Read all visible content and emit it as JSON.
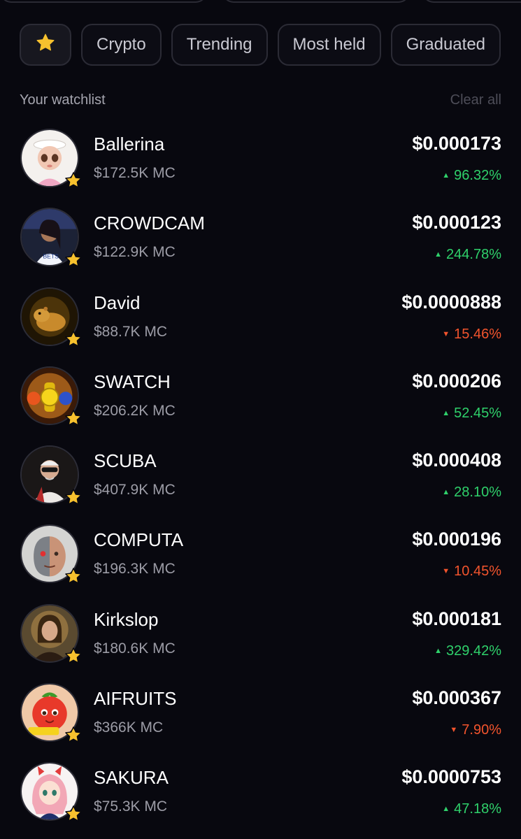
{
  "tabs": [
    {
      "label": "",
      "icon": "star-icon"
    },
    {
      "label": "Crypto"
    },
    {
      "label": "Trending"
    },
    {
      "label": "Most held"
    },
    {
      "label": "Graduated"
    }
  ],
  "watchlist": {
    "title": "Your watchlist",
    "clear_label": "Clear all",
    "items": [
      {
        "name": "Ballerina",
        "mc": "$172.5K MC",
        "price": "$0.000173",
        "change": "96.32%",
        "direction": "up",
        "avatar": "ballerina-avatar-icon"
      },
      {
        "name": "CROWDCAM",
        "mc": "$122.9K MC",
        "price": "$0.000123",
        "change": "244.78%",
        "direction": "up",
        "avatar": "crowdcam-avatar-icon"
      },
      {
        "name": "David",
        "mc": "$88.7K MC",
        "price": "$0.0000888",
        "change": "15.46%",
        "direction": "down",
        "avatar": "capybara-avatar-icon"
      },
      {
        "name": "SWATCH",
        "mc": "$206.2K MC",
        "price": "$0.000206",
        "change": "52.45%",
        "direction": "up",
        "avatar": "watches-avatar-icon"
      },
      {
        "name": "SCUBA",
        "mc": "$407.9K MC",
        "price": "$0.000408",
        "change": "28.10%",
        "direction": "up",
        "avatar": "scuba-avatar-icon"
      },
      {
        "name": "COMPUTA",
        "mc": "$196.3K MC",
        "price": "$0.000196",
        "change": "10.45%",
        "direction": "down",
        "avatar": "cyborg-avatar-icon"
      },
      {
        "name": "Kirkslop",
        "mc": "$180.6K MC",
        "price": "$0.000181",
        "change": "329.42%",
        "direction": "up",
        "avatar": "portrait-avatar-icon"
      },
      {
        "name": "AIFRUITS",
        "mc": "$366K MC",
        "price": "$0.000367",
        "change": "7.90%",
        "direction": "down",
        "avatar": "strawberry-avatar-icon"
      },
      {
        "name": "SAKURA",
        "mc": "$75.3K MC",
        "price": "$0.0000753",
        "change": "47.18%",
        "direction": "up",
        "avatar": "anime-girl-avatar-icon"
      }
    ]
  },
  "colors": {
    "background": "#08080f",
    "up": "#2fd16b",
    "down": "#f2542d",
    "star": "#f7c12e"
  }
}
